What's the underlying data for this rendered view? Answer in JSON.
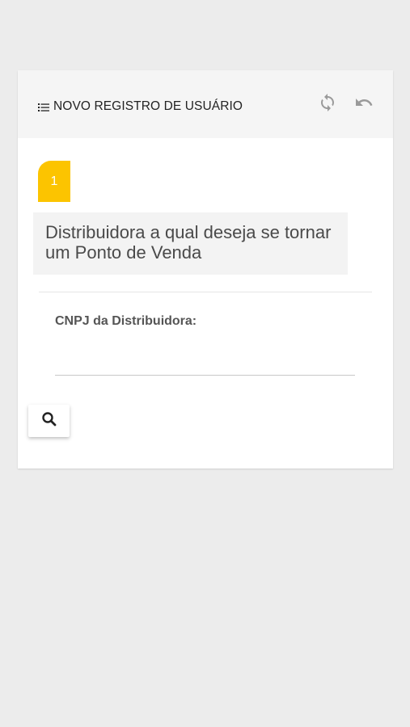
{
  "header": {
    "title": "NOVO REGISTRO DE USUÁRIO",
    "list_icon": "list-icon",
    "actions": [
      {
        "name": "refresh",
        "icon": "refresh-icon"
      },
      {
        "name": "undo",
        "icon": "undo-icon"
      }
    ]
  },
  "step": {
    "number": "1",
    "question": "Distribuidora a qual deseja se tornar um Ponto de Venda",
    "badge_color": "#fcc400"
  },
  "form": {
    "cnpj_label": "CNPJ da Distribuidora:",
    "cnpj_value": "",
    "search_icon": "search-icon"
  },
  "colors": {
    "background": "#ececec",
    "card": "#ffffff",
    "header_bg": "#f5f5f5",
    "accent": "#fcc400"
  }
}
